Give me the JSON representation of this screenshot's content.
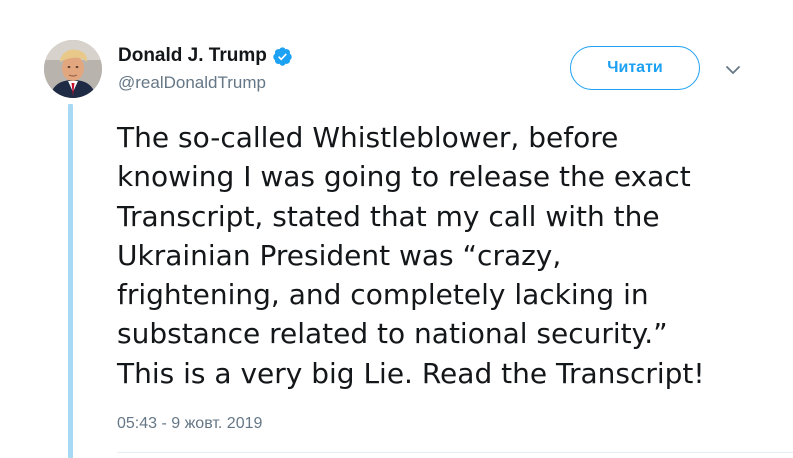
{
  "author": {
    "display_name": "Donald J. Trump",
    "handle": "@realDonaldTrump",
    "verified": true,
    "avatar": "profile-photo"
  },
  "actions": {
    "follow_label": "Читати",
    "menu_icon": "chevron-down-icon"
  },
  "tweet": {
    "text_lines": [
      "The so-called Whistleblower, before",
      "knowing I was going to release the exact",
      "Transcript, stated that my call with the",
      "Ukrainian President was “crazy,",
      "frightening, and completely lacking in",
      "substance related to national security.”",
      "This is a very big Lie. Read the Transcript!"
    ],
    "timestamp": "05:43 - 9 жовт. 2019"
  },
  "colors": {
    "accent": "#1da1f2",
    "thread_line": "#a7d8f4",
    "text": "#14171a",
    "muted": "#657786"
  }
}
